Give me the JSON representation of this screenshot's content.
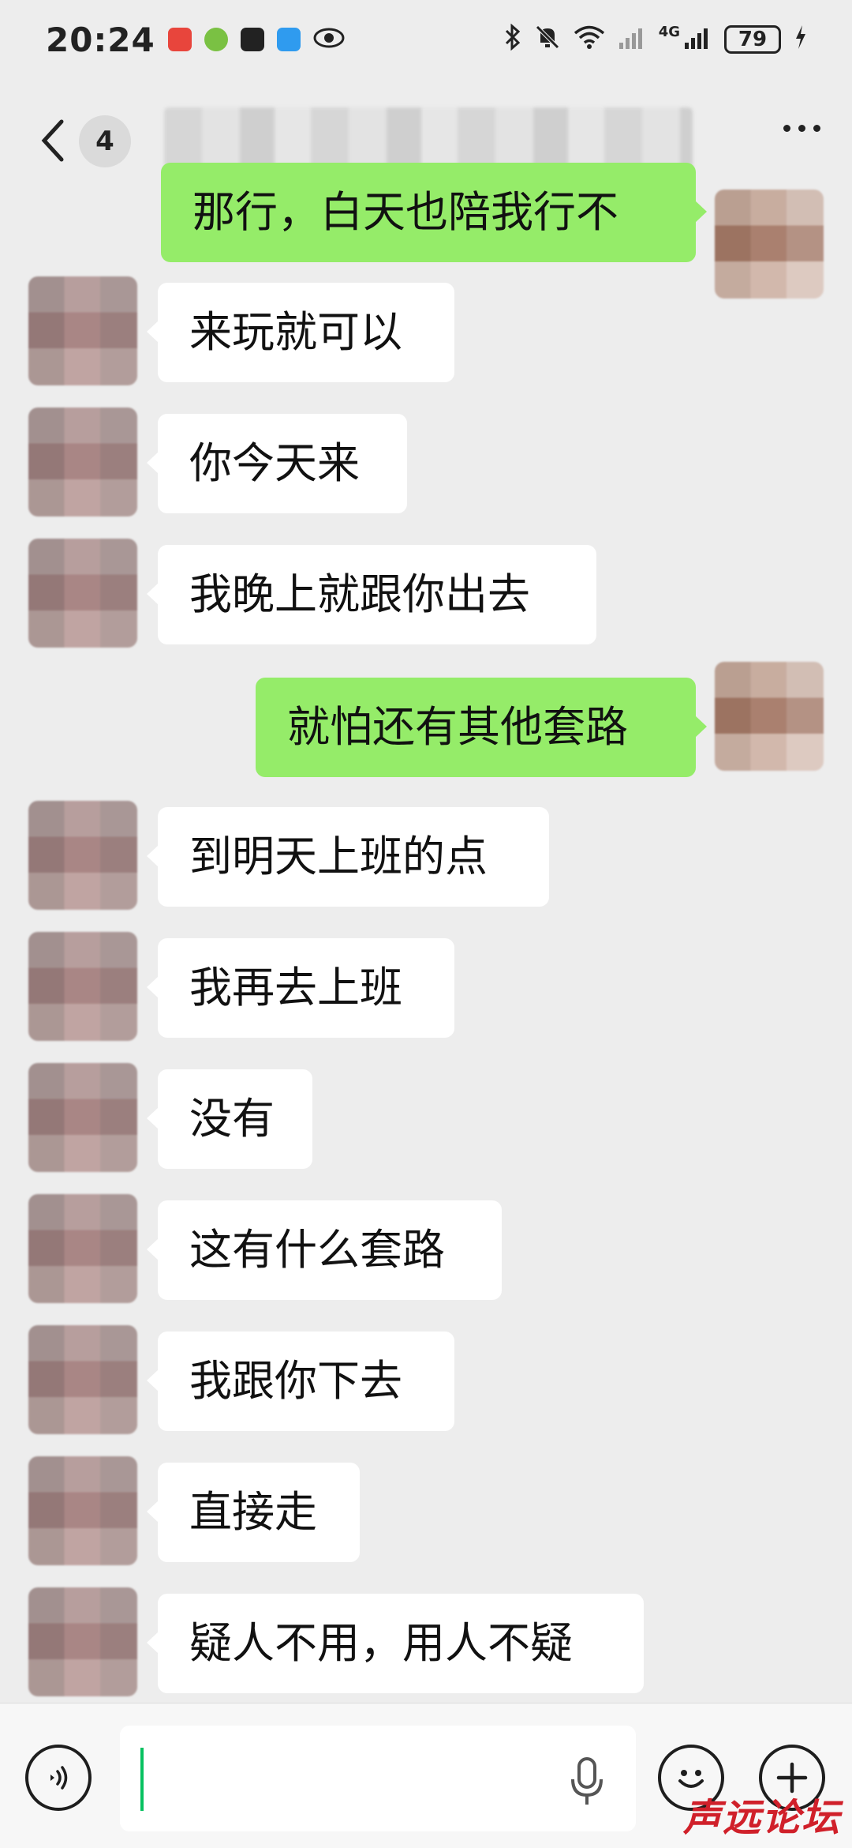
{
  "status_bar": {
    "time": "20:24",
    "network": "4G",
    "battery": "79"
  },
  "header": {
    "unread_count": "4"
  },
  "messages": [
    {
      "from": "self",
      "text": "那行，白天也陪我行不"
    },
    {
      "from": "other",
      "text": "来玩就可以"
    },
    {
      "from": "other",
      "text": "你今天来"
    },
    {
      "from": "other",
      "text": "我晚上就跟你出去"
    },
    {
      "from": "self",
      "text": "就怕还有其他套路"
    },
    {
      "from": "other",
      "text": "到明天上班的点"
    },
    {
      "from": "other",
      "text": "我再去上班"
    },
    {
      "from": "other",
      "text": "没有"
    },
    {
      "from": "other",
      "text": "这有什么套路"
    },
    {
      "from": "other",
      "text": "我跟你下去"
    },
    {
      "from": "other",
      "text": "直接走"
    },
    {
      "from": "other",
      "text": "疑人不用，用人不疑"
    }
  ],
  "input_bar": {
    "text_value": ""
  },
  "watermark": "声远论坛",
  "colors": {
    "background": "#ededed",
    "bubble_self": "#95ec69",
    "bubble_other": "#ffffff",
    "cursor": "#07c160"
  }
}
